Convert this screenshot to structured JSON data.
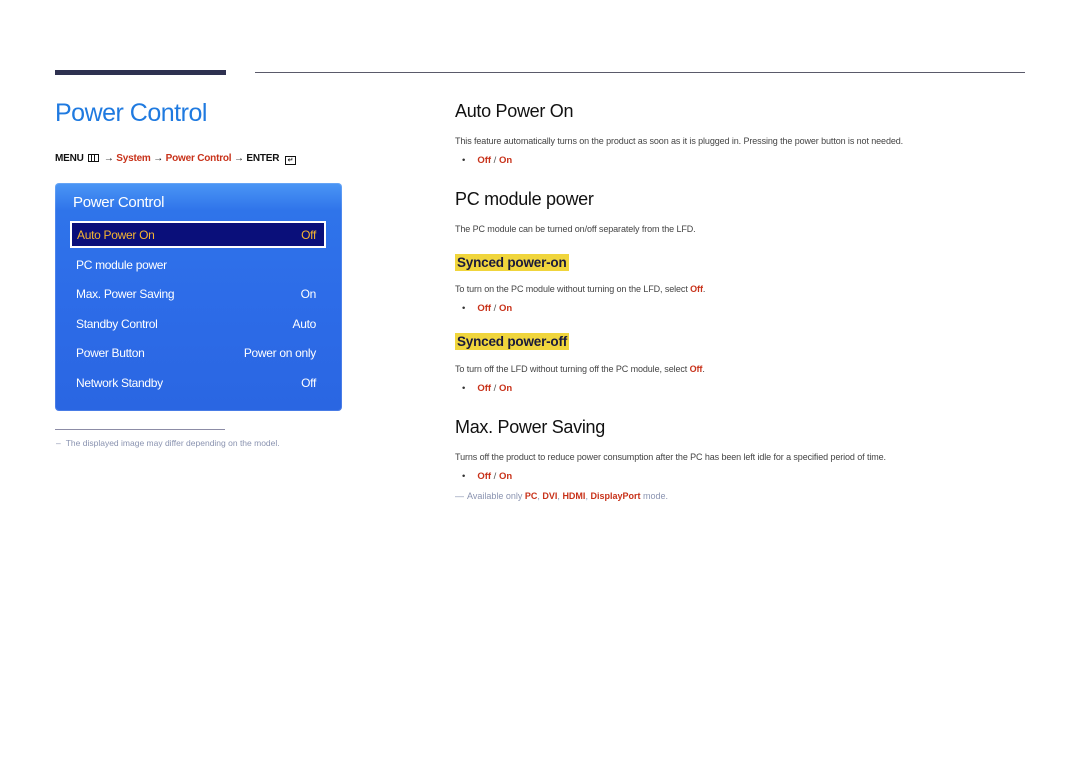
{
  "page": {
    "title": "Power Control",
    "breadcrumb": {
      "menu": "MENU",
      "arrow": "→",
      "system": "System",
      "power_control": "Power Control",
      "enter": "ENTER",
      "menu_icon": "menu-icon",
      "enter_icon": "enter-icon"
    },
    "footnote": {
      "dash": "–",
      "text": "The displayed image may differ depending on the model."
    }
  },
  "osd": {
    "title": "Power Control",
    "items": [
      {
        "label": "Auto Power On",
        "value": "Off",
        "selected": true
      },
      {
        "label": "PC module power",
        "value": ""
      },
      {
        "label": "Max. Power Saving",
        "value": "On"
      },
      {
        "label": "Standby Control",
        "value": "Auto"
      },
      {
        "label": "Power Button",
        "value": "Power on only"
      },
      {
        "label": "Network Standby",
        "value": "Off"
      }
    ],
    "colors": {
      "panel": "#2d6ce8",
      "selected_bg": "#0a0f7a",
      "selected_text": "#f6b531"
    }
  },
  "sections": {
    "auto_power_on": {
      "heading": "Auto Power On",
      "desc": "This feature automatically turns on the product as soon as it is plugged in. Pressing the power button is not needed.",
      "opt_off": "Off",
      "opt_sep": " / ",
      "opt_on": "On"
    },
    "pc_module_power": {
      "heading": "PC module power",
      "desc": "The PC module can be turned on/off separately from the LFD.",
      "synced_on": {
        "heading": "Synced power-on",
        "desc": "To turn on the PC module without turning on the LFD, select ",
        "desc_value": "Off",
        "desc_end": ".",
        "opt_off": "Off",
        "opt_sep": " / ",
        "opt_on": "On"
      },
      "synced_off": {
        "heading": "Synced power-off",
        "desc": "To turn off the LFD without turning off the PC module, select ",
        "desc_value": "Off",
        "desc_end": ".",
        "opt_off": "Off",
        "opt_sep": " / ",
        "opt_on": "On"
      }
    },
    "max_power_saving": {
      "heading": "Max. Power Saving",
      "desc": "Turns off the product to reduce power consumption after the PC has been left idle for a specified period of time.",
      "opt_off": "Off",
      "opt_sep": " / ",
      "opt_on": "On",
      "note": {
        "dash": "—",
        "prefix": "Available only ",
        "modes": [
          "PC",
          "DVI",
          "HDMI",
          "DisplayPort"
        ],
        "suffix": " mode."
      }
    }
  },
  "colors": {
    "accent_blue": "#1f7ae0",
    "accent_red": "#c8321a",
    "highlight_yellow": "#f0d53c"
  }
}
